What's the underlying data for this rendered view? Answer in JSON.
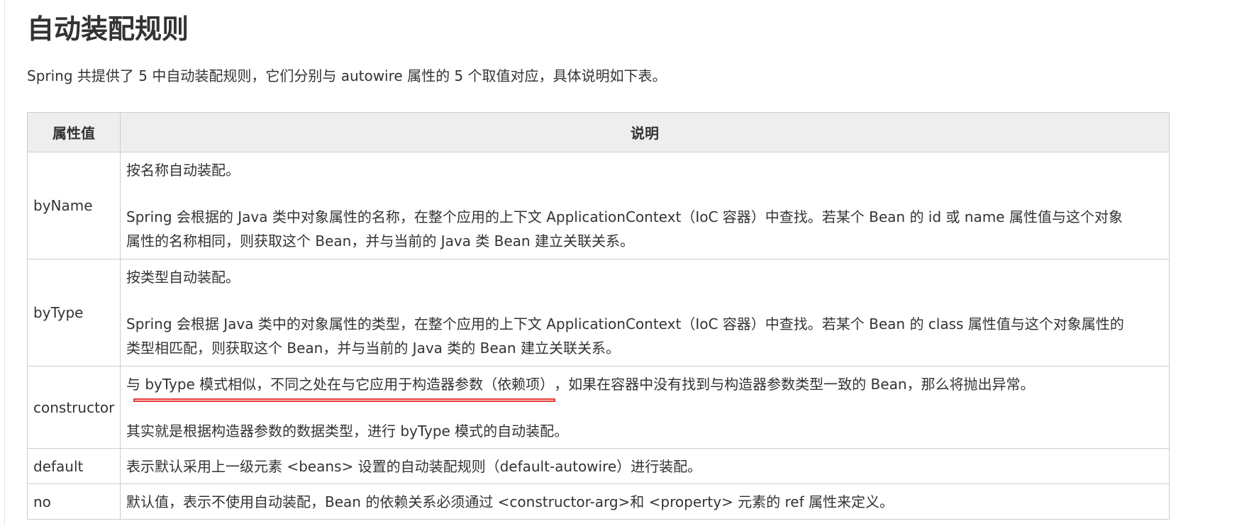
{
  "page": {
    "title": "自动装配规则",
    "intro": "Spring 共提供了 5 中自动装配规则，它们分别与 autowire 属性的 5 个取值对应，具体说明如下表。"
  },
  "table": {
    "headers": [
      "属性值",
      "说明"
    ],
    "rows": [
      {
        "value": "byName",
        "desc1": "按名称自动装配。",
        "desc2": "Spring 会根据的 Java 类中对象属性的名称，在整个应用的上下文 ApplicationContext（IoC 容器）中查找。若某个 Bean 的 id 或 name 属性值与这个对象",
        "desc3": "属性的名称相同，则获取这个 Bean，并与当前的 Java 类 Bean 建立关联关系。"
      },
      {
        "value": "byType",
        "desc1": "按类型自动装配。",
        "desc2": "Spring 会根据 Java 类中的对象属性的类型，在整个应用的上下文 ApplicationContext（IoC 容器）中查找。若某个 Bean 的 class 属性值与这个对象属性的",
        "desc3": "类型相匹配，则获取这个 Bean，并与当前的 Java 类的 Bean 建立关联关系。"
      },
      {
        "value": "constructor",
        "desc1a": "与 byType 模式相似，不同之处在与它应用于构造器参数（依赖项）",
        "desc1b": "，如果在容器中没有找到与构造器参数类型一致的 Bean，那么将抛出异常。",
        "desc2": "其实就是根据构造器参数的数据类型，进行 byType 模式的自动装配。"
      },
      {
        "value": "default",
        "desc1": "表示默认采用上一级元素 <beans> 设置的自动装配规则（default-autowire）进行装配。"
      },
      {
        "value": "no",
        "desc1": "默认值，表示不使用自动装配，Bean 的依赖关系必须通过 <constructor-arg>和 <property> 元素的 ref 属性来定义。"
      }
    ]
  },
  "colors": {
    "text": "#333333",
    "header_bg": "#eeeeee",
    "border": "#cccccc",
    "annotation": "#e53935"
  }
}
